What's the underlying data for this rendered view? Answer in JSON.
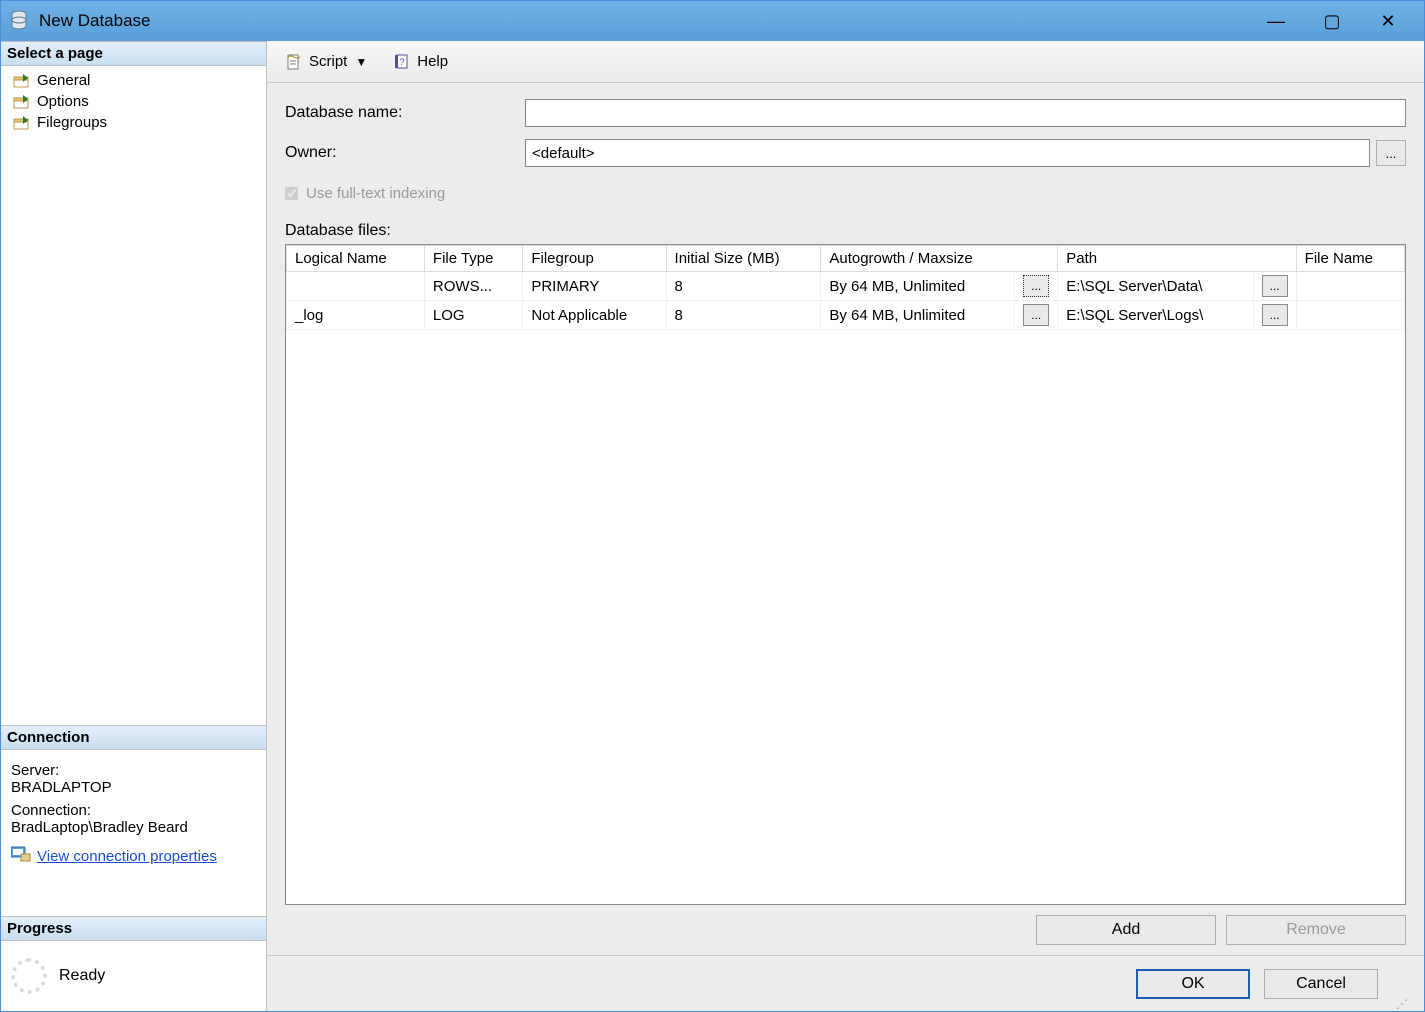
{
  "window": {
    "title": "New Database",
    "controls": {
      "min": "—",
      "max": "▢",
      "close": "✕"
    }
  },
  "sidebar": {
    "select_page_header": "Select a page",
    "pages": [
      {
        "label": "General"
      },
      {
        "label": "Options"
      },
      {
        "label": "Filegroups"
      }
    ],
    "connection_header": "Connection",
    "server_label": "Server:",
    "server_value": "BRADLAPTOP",
    "connection_label": "Connection:",
    "connection_value": "BradLaptop\\Bradley Beard",
    "view_conn_props": "View connection properties",
    "progress_header": "Progress",
    "progress_status": "Ready"
  },
  "toolbar": {
    "script_label": "Script",
    "help_label": "Help"
  },
  "form": {
    "db_name_label": "Database name:",
    "db_name_value": "",
    "owner_label": "Owner:",
    "owner_value": "<default>",
    "owner_browse": "...",
    "fulltext_label": "Use full-text indexing",
    "fulltext_checked": true,
    "files_label": "Database files:",
    "columns": [
      "Logical Name",
      "File Type",
      "Filegroup",
      "Initial Size (MB)",
      "Autogrowth / Maxsize",
      "Path",
      "File Name"
    ],
    "rows": [
      {
        "logical_name": "",
        "file_type": "ROWS...",
        "filegroup": "PRIMARY",
        "initial_size": "8",
        "autogrowth": "By 64 MB, Unlimited",
        "path": "E:\\SQL Server\\Data\\",
        "file_name": ""
      },
      {
        "logical_name": "_log",
        "file_type": "LOG",
        "filegroup": "Not Applicable",
        "initial_size": "8",
        "autogrowth": "By 64 MB, Unlimited",
        "path": "E:\\SQL Server\\Logs\\",
        "file_name": ""
      }
    ],
    "add_label": "Add",
    "remove_label": "Remove"
  },
  "footer": {
    "ok": "OK",
    "cancel": "Cancel"
  }
}
